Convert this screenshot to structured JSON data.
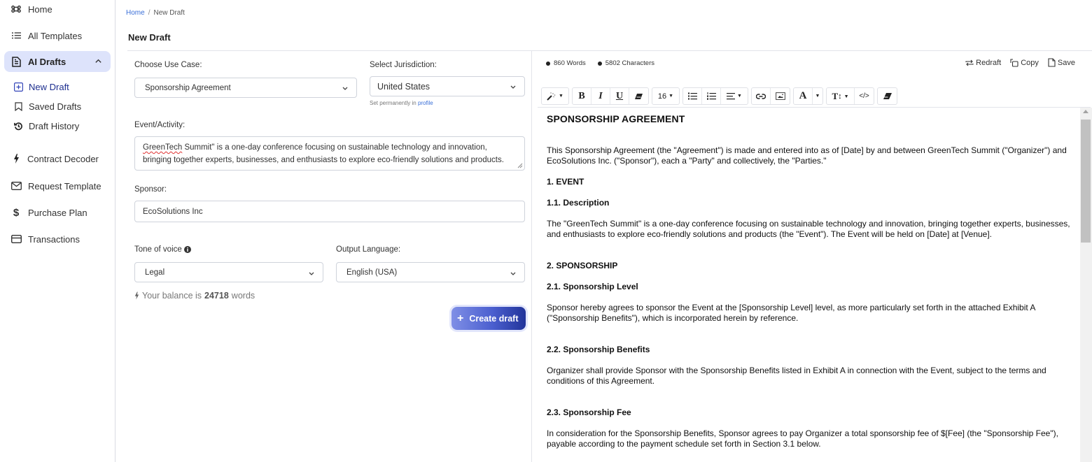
{
  "sidebar": {
    "home": "Home",
    "all_templates": "All Templates",
    "ai_drafts": "AI Drafts",
    "sub_items": [
      {
        "label": "New Draft",
        "icon": "plus-square-icon",
        "active": true
      },
      {
        "label": "Saved Drafts",
        "icon": "bookmark-icon"
      },
      {
        "label": "Draft History",
        "icon": "history-icon"
      }
    ],
    "contract_decoder": "Contract Decoder",
    "request_template": "Request Template",
    "purchase_plan": "Purchase Plan",
    "transactions": "Transactions"
  },
  "breadcrumb": {
    "home": "Home",
    "separator": "/",
    "current": "New Draft"
  },
  "page_title": "New Draft",
  "form": {
    "use_case_label": "Choose Use Case:",
    "use_case_value": "Sponsorship Agreement",
    "jurisdiction_label": "Select Jurisdiction:",
    "jurisdiction_value": "United States",
    "jurisdiction_hint_prefix": "Set permanently in",
    "jurisdiction_hint_link": "profile",
    "event_label": "Event/Activity:",
    "event_value_spell": "GreenTech",
    "event_value_rest": " Summit\" is a one-day conference focusing on sustainable technology and innovation, bringing together experts, businesses, and enthusiasts to explore eco-friendly solutions and products.",
    "sponsor_label": "Sponsor:",
    "sponsor_value": "EcoSolutions Inc",
    "tone_label": "Tone of voice",
    "tone_value": "Legal",
    "language_label": "Output Language:",
    "language_value": "English (USA)",
    "balance_prefix": "Your balance is",
    "balance_value": "24718",
    "balance_suffix": "words",
    "create_label": "Create draft"
  },
  "editor": {
    "words": "860 Words",
    "characters": "5802 Characters",
    "redraft": "Redraft",
    "copy": "Copy",
    "save": "Save",
    "font_size": "16",
    "document": {
      "title": "SPONSORSHIP AGREEMENT",
      "intro": "This Sponsorship Agreement (the \"Agreement\") is made and entered into as of [Date] by and between GreenTech Summit (\"Organizer\") and EcoSolutions Inc. (\"Sponsor\"), each a \"Party\" and collectively, the \"Parties.\"",
      "s1": "1. EVENT",
      "s1_1": "1.1. Description",
      "s1_1_text": "The \"GreenTech Summit\" is a one-day conference focusing on sustainable technology and innovation, bringing together experts, businesses, and enthusiasts to explore eco-friendly solutions and products (the \"Event\"). The Event will be held on [Date] at [Venue].",
      "s2": "2. SPONSORSHIP",
      "s2_1": "2.1. Sponsorship Level",
      "s2_1_text": "Sponsor hereby agrees to sponsor the Event at the [Sponsorship Level] level, as more particularly set forth in the attached Exhibit A (\"Sponsorship Benefits\"), which is incorporated herein by reference.",
      "s2_2": "2.2. Sponsorship Benefits",
      "s2_2_text": "Organizer shall provide Sponsor with the Sponsorship Benefits listed in Exhibit A in connection with the Event, subject to the terms and conditions of this Agreement.",
      "s2_3": "2.3. Sponsorship Fee",
      "s2_3_text": "In consideration for the Sponsorship Benefits, Sponsor agrees to pay Organizer a total sponsorship fee of $[Fee] (the \"Sponsorship Fee\"), payable according to the payment schedule set forth in Section 3.1 below."
    }
  },
  "colors": {
    "accent": "#3a6fd8",
    "active_nav_bg": "#dde3fb",
    "button_gradient_start": "#7f8fe6",
    "button_gradient_end": "#22349a"
  }
}
